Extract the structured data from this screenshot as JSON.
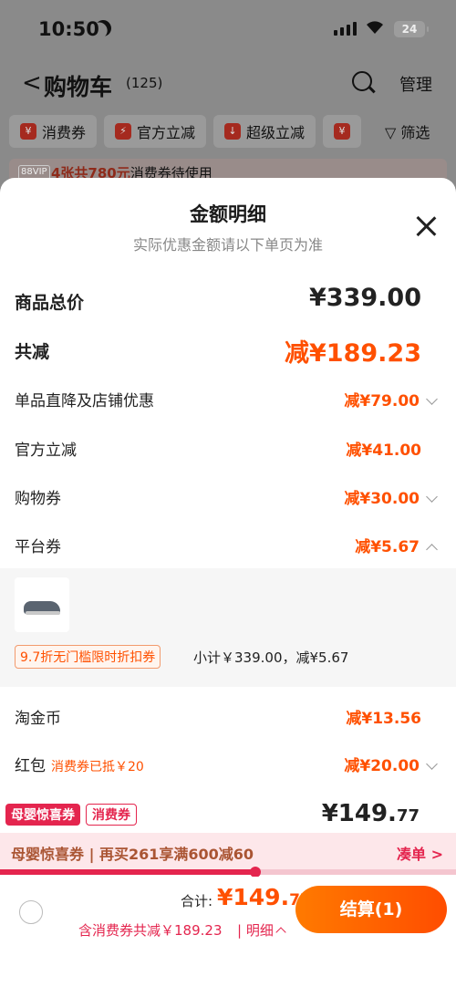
{
  "status": {
    "time": "10:50",
    "battery": "24"
  },
  "header": {
    "back": "<",
    "title": "购物车",
    "count": "(125)",
    "manage": "管理",
    "chips": [
      {
        "icon": "¥",
        "label": "消费券"
      },
      {
        "icon": "⚡",
        "label": "官方立减"
      },
      {
        "icon": "↓",
        "label": "超级立减"
      },
      {
        "icon": "¥",
        "label": "…"
      }
    ],
    "filter": "▽ 筛选",
    "vip_badge": "88VIP",
    "vip_highlight": "4张共780元",
    "vip_text": "消费券待使用"
  },
  "sheet": {
    "title": "金额明细",
    "subtitle": "实际优惠金额请以下单页为准",
    "rows": {
      "total_label": "商品总价",
      "total_value": "¥339.00",
      "reduce_label": "共减",
      "reduce_value": "减¥189.23",
      "single_label": "单品直降及店铺优惠",
      "single_value": "减¥79.00",
      "official_label": "官方立减",
      "official_value": "减¥41.00",
      "shopping_label": "购物券",
      "shopping_value": "减¥30.00",
      "platform_label": "平台券",
      "platform_value": "减¥5.67",
      "coin_label": "淘金币",
      "coin_value": "减¥13.56",
      "redpack_label": "红包",
      "redpack_note": "消费券已抵￥20",
      "redpack_value": "减¥20.00"
    },
    "panel": {
      "coupon": "9.7折无门槛限时折扣券",
      "subtotal": "小计￥339.00，减¥5.67"
    },
    "tags": {
      "tag1": "母婴惊喜券",
      "tag2": "消费券"
    },
    "final_price_main": "¥149.",
    "final_price_cents": "77",
    "promo": {
      "title": "母婴惊喜券",
      "sep": " | ",
      "desc": "再买261享满600减60",
      "action": "凑单 >"
    },
    "progress": 0.56
  },
  "checkout": {
    "sum_label": "合计:",
    "sum_main": "¥149.",
    "sum_cents": "77",
    "discount": "含消费券共减￥189.23",
    "detail": "| 明细",
    "pay": "结算(1)"
  },
  "colors": {
    "accent": "#ff5000",
    "pink": "#e4254e"
  }
}
